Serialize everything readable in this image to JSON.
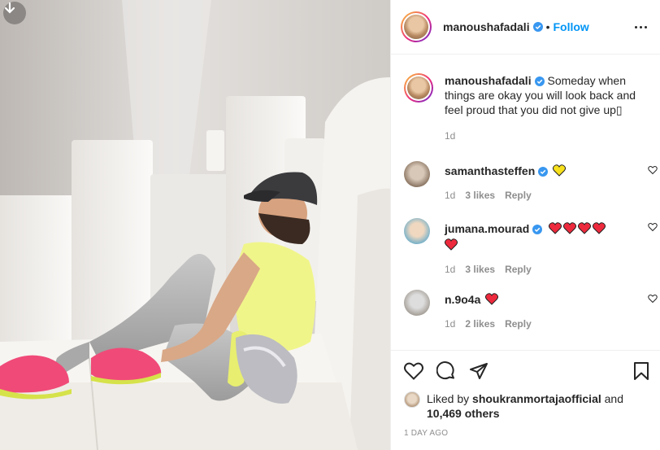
{
  "post": {
    "author": "manoushafadali",
    "follow_dot": "•",
    "follow_label": "Follow",
    "caption": "Someday when things are okay you will look back and feel proud that you did not give up▯",
    "caption_age": "1d"
  },
  "comments": [
    {
      "user": "samanthasteffen",
      "verified": true,
      "hearts": [
        "yellow"
      ],
      "age": "1d",
      "likes": "3 likes",
      "reply": "Reply"
    },
    {
      "user": "jumana.mourad",
      "verified": true,
      "hearts": [
        "red",
        "red",
        "red",
        "red",
        "red"
      ],
      "age": "1d",
      "likes": "3 likes",
      "reply": "Reply"
    },
    {
      "user": "n.9o4a",
      "verified": false,
      "hearts": [
        "red"
      ],
      "age": "1d",
      "likes": "2 likes",
      "reply": "Reply"
    }
  ],
  "likes": {
    "prefix": "Liked by",
    "liked_by": "shoukranmortajaofficial",
    "and": "and",
    "others": "10,469 others"
  },
  "timestamp": "1 DAY AGO",
  "icons": {
    "download": "arrow-down-icon",
    "like": "heart-outline-icon",
    "comment": "comment-bubble-icon",
    "share": "paper-plane-icon",
    "save": "bookmark-icon",
    "more": "ellipsis-icon",
    "verified": "verified-badge-icon"
  },
  "colors": {
    "link_blue": "#0095f6",
    "verified_blue": "#3897f0",
    "heart_red": "#ed2a3d",
    "heart_yellow": "#f7e01c",
    "shirt": "#f0f58a",
    "shoes": "#f04a78"
  }
}
